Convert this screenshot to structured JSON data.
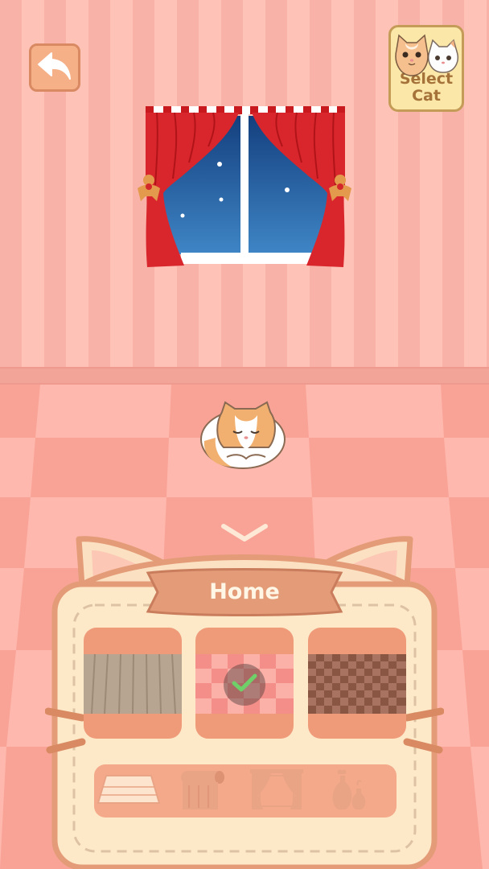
{
  "header": {
    "back_icon": "back-arrow-icon",
    "select_cat_label": "Select\nCat"
  },
  "room": {
    "wall_color": "#f8b2a7",
    "floor_color": "#ffb3a8",
    "window_sky": "#2f73b3",
    "curtain_color": "#d9262c",
    "cat_state": "sleeping"
  },
  "panel": {
    "title": "Home",
    "options": [
      {
        "name": "wood-floor",
        "selected": false,
        "color": "#b8a48e"
      },
      {
        "name": "pink-check-floor",
        "selected": true,
        "color": "#f8a3a0"
      },
      {
        "name": "brown-check-floor",
        "selected": false,
        "color": "#8a5542"
      }
    ],
    "categories": [
      {
        "name": "floor",
        "icon": "floor-icon",
        "active": true
      },
      {
        "name": "wallpaper",
        "icon": "wallpaper-roll-icon",
        "active": false
      },
      {
        "name": "curtain",
        "icon": "curtain-icon",
        "active": false
      },
      {
        "name": "decor",
        "icon": "vase-icon",
        "active": false
      }
    ]
  }
}
